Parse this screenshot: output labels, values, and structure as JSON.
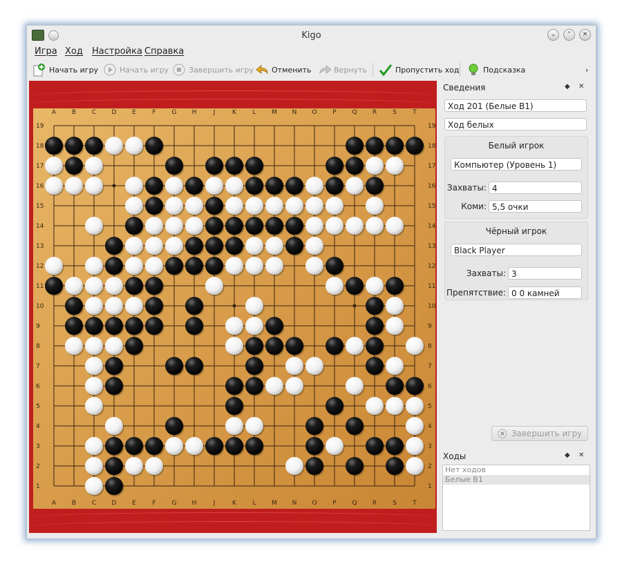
{
  "window": {
    "title": "Kigo"
  },
  "menu": {
    "items": [
      "Игра",
      "Ход",
      "Настройка",
      "Справка"
    ]
  },
  "toolbar": {
    "new_game": "Начать игру",
    "start_game": "Начать игру",
    "finish_game": "Завершить игру",
    "undo": "Отменить",
    "redo": "Вернуть",
    "pass": "Пропустить ход",
    "hint": "Подсказка"
  },
  "board": {
    "columns": [
      "A",
      "B",
      "C",
      "D",
      "E",
      "F",
      "G",
      "H",
      "J",
      "K",
      "L",
      "M",
      "N",
      "O",
      "P",
      "Q",
      "R",
      "S",
      "T"
    ],
    "rows": [
      19,
      18,
      17,
      16,
      15,
      14,
      13,
      12,
      11,
      10,
      9,
      8,
      7,
      6,
      5,
      4,
      3,
      2,
      1
    ],
    "stones": [
      ".................",
      "BBBWWB.........BBBB",
      "WBW...B.BBB...BBWW.",
      "WWW.WBWBWWBBBWBWB..",
      "....WBWWBWWWWWW.W..",
      "..W.BWWWBBBBBWWWWW.",
      "...BWWWBBBWWBW.....",
      "W.WBWWBBBWWW.WB....",
      "BWWWBB..W.....WBWB.",
      ".BWWWB.B..W.....BW.",
      ".BBBBB.B.WWB....BW.B",
      ".WWWB....WBBB.BWB.W",
      "..WB..BB..B.WW..BW.",
      "..WB.....BBWW..W.BB",
      "..W......B....B.WWWB",
      "...W..B..WW..B.B..W",
      "..WBBBWWBBB..BW.BBW",
      "..WBWW......WB.B.BW",
      "..WB...............WB"
    ]
  },
  "info": {
    "header": "Сведения",
    "move": "Ход 201 (Белые B1)",
    "turn": "Ход белых",
    "white": {
      "title": "Белый игрок",
      "player": "Компьютер (Уровень 1)",
      "captures_label": "Захваты:",
      "captures": "4",
      "komi_label": "Коми:",
      "komi": "5,5 очки"
    },
    "black": {
      "title": "Чёрный игрок",
      "player": "Black Player",
      "captures_label": "Захваты:",
      "captures": "3",
      "handicap_label": "Препятствие:",
      "handicap": "0 0 камней"
    },
    "end_game": "Завершить игру"
  },
  "moves": {
    "header": "Ходы",
    "items": [
      "Нет ходов",
      "Белые B1"
    ]
  }
}
